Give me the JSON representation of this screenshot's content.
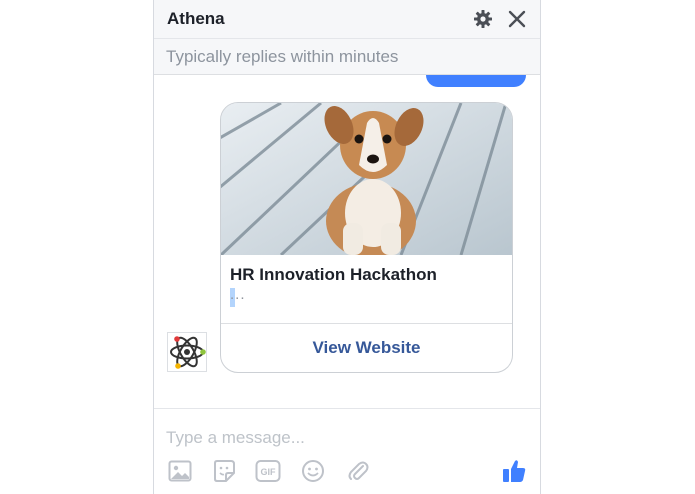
{
  "header": {
    "title": "Athena",
    "settings_icon": "gear-icon",
    "close_icon": "close-icon"
  },
  "subheader": {
    "status": "Typically replies within minutes"
  },
  "card": {
    "image": "puppy-photo",
    "title": "HR Innovation Hackathon",
    "subtitle": "...",
    "button_label": "View Website"
  },
  "composer": {
    "placeholder": "Type a message...",
    "value": "",
    "tools": [
      "photo-icon",
      "sticker-icon",
      "gif-icon",
      "emoji-icon",
      "attachment-icon",
      "like-icon"
    ],
    "gif_label": "GIF"
  },
  "colors": {
    "accent": "#4080ff",
    "link": "#365899",
    "header_bg": "#f6f7f9"
  }
}
